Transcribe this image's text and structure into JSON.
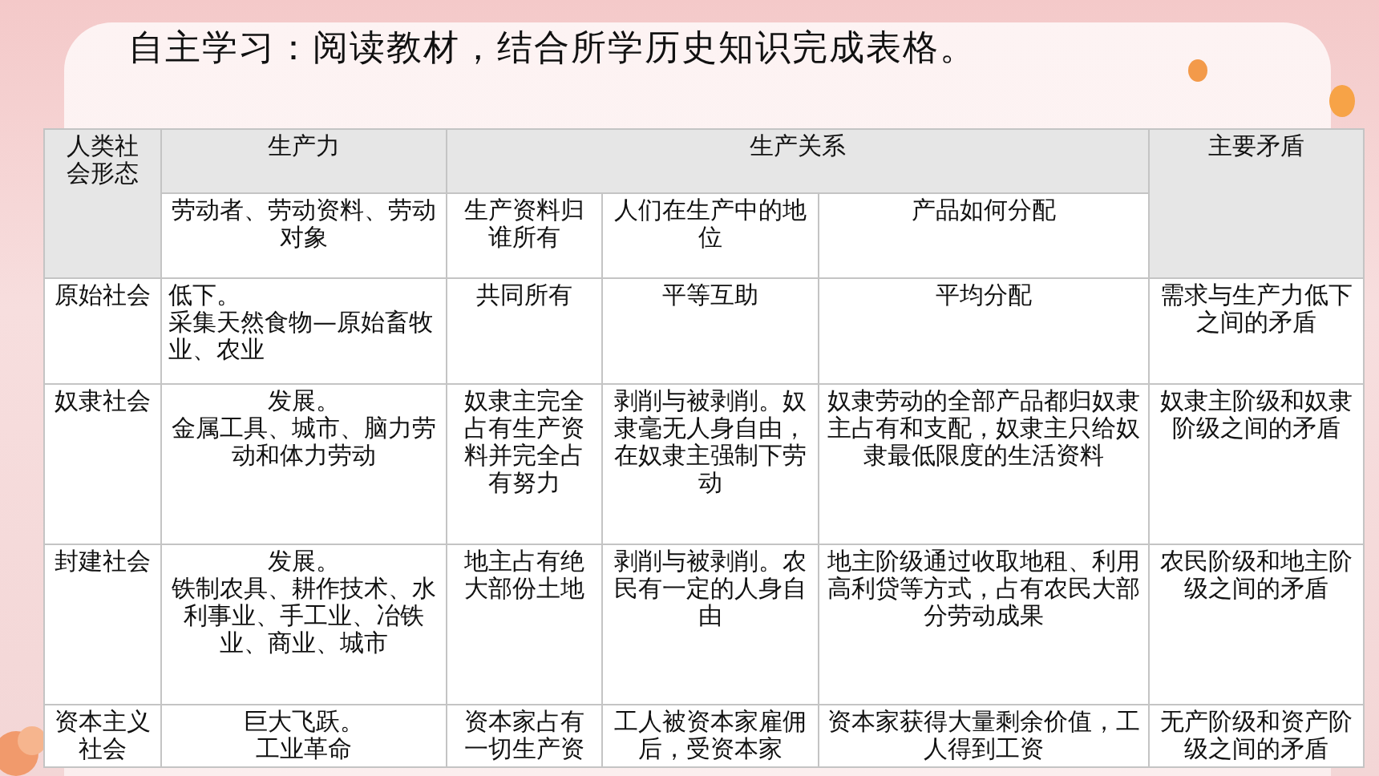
{
  "title": "自主学习：阅读教材，结合所学历史知识完成表格。",
  "table": {
    "header": {
      "society": "人类社会形态",
      "productivity": "生产力",
      "productivity_sub": "劳动者、劳动资料、劳动对象",
      "relations": "生产关系",
      "relations_sub": [
        "生产资料归谁所有",
        "人们在生产中的地位",
        "产品如何分配"
      ],
      "contradiction": "主要矛盾"
    },
    "rows": [
      {
        "society": "原始社会",
        "productivity": {
          "level": "低下。",
          "detail": "采集天然食物—原始畜牧业、农业"
        },
        "cells": [
          "共同所有",
          "平等互助",
          "平均分配",
          "需求与生产力低下之间的矛盾"
        ]
      },
      {
        "society": "奴隶社会",
        "productivity": {
          "level": "发展。",
          "detail": "金属工具、城市、脑力劳动和体力劳动"
        },
        "cells": [
          "奴隶主完全占有生产资料并完全占有努力",
          "剥削与被剥削。奴隶毫无人身自由，在奴隶主强制下劳动",
          "奴隶劳动的全部产品都归奴隶主占有和支配，奴隶主只给奴隶最低限度的生活资料",
          "奴隶主阶级和奴隶阶级之间的矛盾"
        ]
      },
      {
        "society": "封建社会",
        "productivity": {
          "level": "发展。",
          "detail": "铁制农具、耕作技术、水利事业、手工业、冶铁业、商业、城市"
        },
        "cells": [
          "地主占有绝大部份土地",
          "剥削与被剥削。农民有一定的人身自由",
          "地主阶级通过收取地租、利用高利贷等方式，占有农民大部分劳动成果",
          "农民阶级和地主阶级之间的矛盾"
        ]
      },
      {
        "society": "资本主义社会",
        "productivity": {
          "level": "巨大飞跃。",
          "detail": "工业革命"
        },
        "cells": [
          "资本家占有一切生产资",
          "工人被资本家雇佣后，受资本家",
          "资本家获得大量剩余价值，工人得到工资",
          "无产阶级和资产阶级之间的矛盾"
        ]
      }
    ]
  }
}
